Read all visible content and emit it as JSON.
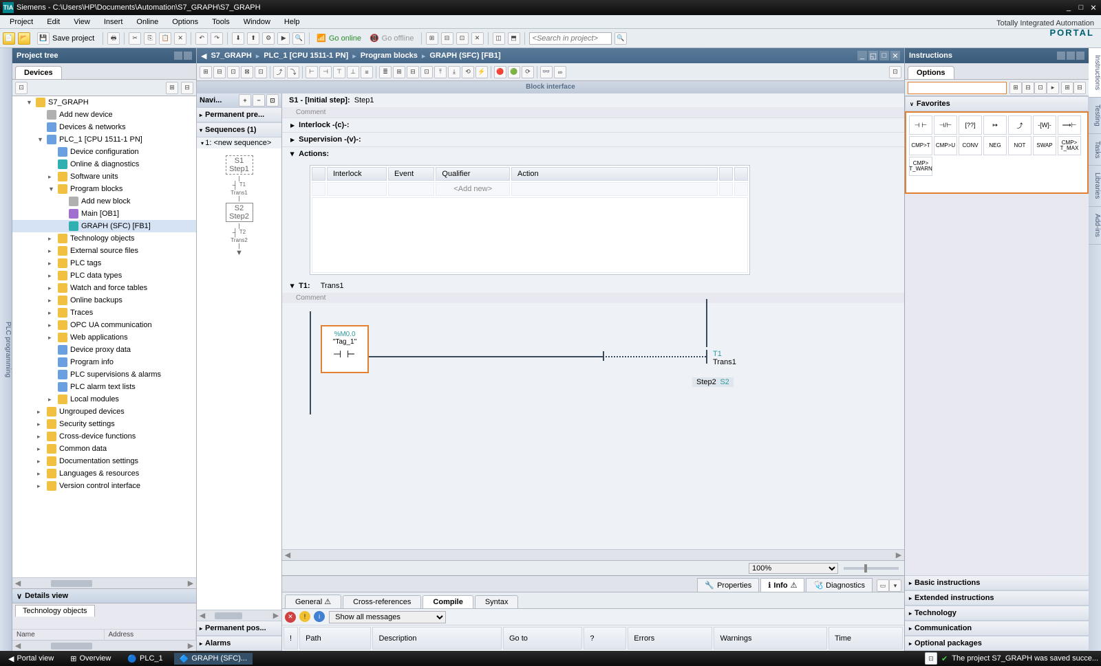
{
  "title": "Siemens  -  C:\\Users\\HP\\Documents\\Automation\\S7_GRAPH\\S7_GRAPH",
  "menu": [
    "Project",
    "Edit",
    "View",
    "Insert",
    "Online",
    "Options",
    "Tools",
    "Window",
    "Help"
  ],
  "brand": {
    "line1": "Totally Integrated Automation",
    "line2": "PORTAL"
  },
  "toolbar": {
    "save": "Save project",
    "goonline": "Go online",
    "gooffline": "Go offline",
    "search_ph": "<Search in project>"
  },
  "projectTree": {
    "title": "Project tree",
    "tab": "Devices",
    "sideTab": "PLC programming"
  },
  "tree": [
    {
      "lvl": 0,
      "exp": "▼",
      "icon": "ic-folder",
      "label": "S7_GRAPH"
    },
    {
      "lvl": 1,
      "exp": "",
      "icon": "ic-grey",
      "label": "Add new device"
    },
    {
      "lvl": 1,
      "exp": "",
      "icon": "ic-block",
      "label": "Devices & networks"
    },
    {
      "lvl": 1,
      "exp": "▼",
      "icon": "ic-block",
      "label": "PLC_1 [CPU 1511-1 PN]"
    },
    {
      "lvl": 2,
      "exp": "",
      "icon": "ic-block",
      "label": "Device configuration"
    },
    {
      "lvl": 2,
      "exp": "",
      "icon": "ic-cyan",
      "label": "Online & diagnostics"
    },
    {
      "lvl": 2,
      "exp": "▸",
      "icon": "ic-folder",
      "label": "Software units"
    },
    {
      "lvl": 2,
      "exp": "▼",
      "icon": "ic-folder",
      "label": "Program blocks"
    },
    {
      "lvl": 3,
      "exp": "",
      "icon": "ic-grey",
      "label": "Add new block"
    },
    {
      "lvl": 3,
      "exp": "",
      "icon": "ic-purple",
      "label": "Main [OB1]"
    },
    {
      "lvl": 3,
      "exp": "",
      "icon": "ic-cyan",
      "label": "GRAPH (SFC) [FB1]",
      "sel": true
    },
    {
      "lvl": 2,
      "exp": "▸",
      "icon": "ic-folder",
      "label": "Technology objects"
    },
    {
      "lvl": 2,
      "exp": "▸",
      "icon": "ic-folder",
      "label": "External source files"
    },
    {
      "lvl": 2,
      "exp": "▸",
      "icon": "ic-folder",
      "label": "PLC tags"
    },
    {
      "lvl": 2,
      "exp": "▸",
      "icon": "ic-folder",
      "label": "PLC data types"
    },
    {
      "lvl": 2,
      "exp": "▸",
      "icon": "ic-folder",
      "label": "Watch and force tables"
    },
    {
      "lvl": 2,
      "exp": "▸",
      "icon": "ic-folder",
      "label": "Online backups"
    },
    {
      "lvl": 2,
      "exp": "▸",
      "icon": "ic-folder",
      "label": "Traces"
    },
    {
      "lvl": 2,
      "exp": "▸",
      "icon": "ic-folder",
      "label": "OPC UA communication"
    },
    {
      "lvl": 2,
      "exp": "▸",
      "icon": "ic-folder",
      "label": "Web applications"
    },
    {
      "lvl": 2,
      "exp": "",
      "icon": "ic-block",
      "label": "Device proxy data"
    },
    {
      "lvl": 2,
      "exp": "",
      "icon": "ic-block",
      "label": "Program info"
    },
    {
      "lvl": 2,
      "exp": "",
      "icon": "ic-block",
      "label": "PLC supervisions & alarms"
    },
    {
      "lvl": 2,
      "exp": "",
      "icon": "ic-block",
      "label": "PLC alarm text lists"
    },
    {
      "lvl": 2,
      "exp": "▸",
      "icon": "ic-folder",
      "label": "Local modules"
    },
    {
      "lvl": 1,
      "exp": "▸",
      "icon": "ic-folder",
      "label": "Ungrouped devices"
    },
    {
      "lvl": 1,
      "exp": "▸",
      "icon": "ic-folder",
      "label": "Security settings"
    },
    {
      "lvl": 1,
      "exp": "▸",
      "icon": "ic-folder",
      "label": "Cross-device functions"
    },
    {
      "lvl": 1,
      "exp": "▸",
      "icon": "ic-folder",
      "label": "Common data"
    },
    {
      "lvl": 1,
      "exp": "▸",
      "icon": "ic-folder",
      "label": "Documentation settings"
    },
    {
      "lvl": 1,
      "exp": "▸",
      "icon": "ic-folder",
      "label": "Languages & resources"
    },
    {
      "lvl": 1,
      "exp": "▸",
      "icon": "ic-folder",
      "label": "Version control interface"
    }
  ],
  "detailsView": {
    "title": "Details view",
    "tab": "Technology objects",
    "cols": [
      "Name",
      "Address"
    ]
  },
  "breadcrumb": [
    "S7_GRAPH",
    "PLC_1 [CPU 1511-1 PN]",
    "Program blocks",
    "GRAPH (SFC) [FB1]"
  ],
  "blockIface": "Block interface",
  "nav": {
    "title": "Navi...",
    "permPre": "Permanent pre...",
    "sequences": "Sequences (1)",
    "seq1": "1: <new sequence>",
    "permPost": "Permanent pos...",
    "alarms": "Alarms",
    "step1": "Step1",
    "s1": "S1",
    "t1": "T1",
    "trans1": "Trans1",
    "step2": "Step2",
    "s2": "S2",
    "t2": "T2",
    "trans2": "Trans2"
  },
  "editor": {
    "stepTitle": {
      "id": "S1 - [Initial step]:",
      "name": "Step1"
    },
    "comment": "Comment",
    "interlock": "Interlock -(c)-:",
    "supervision": "Supervision -(v)-:",
    "actions": "Actions:",
    "actCols": [
      "Interlock",
      "Event",
      "Qualifier",
      "Action"
    ],
    "addnew": "<Add new>",
    "trans": {
      "id": "T1:",
      "name": "Trans1",
      "addr": "%M0.0",
      "tag": "\"Tag_1\"",
      "destStep": "Step2",
      "destId": "S2",
      "tId": "T1",
      "tName": "Trans1"
    }
  },
  "zoom": "100%",
  "info": {
    "tabs": {
      "properties": "Properties",
      "info": "Info",
      "diagnostics": "Diagnostics"
    },
    "subtabs": [
      "General",
      "Cross-references",
      "Compile",
      "Syntax"
    ],
    "msgFilter": "Show all messages",
    "cols": [
      "Path",
      "Description",
      "Go to",
      "?",
      "Errors",
      "Warnings",
      "Time"
    ]
  },
  "instructions": {
    "title": "Instructions",
    "options": "Options",
    "favorites": "Favorites",
    "favIcons": [
      "⊣ ⊢",
      "⊣/⊢",
      "[??]",
      "↦",
      "⤴",
      "-[W]-",
      "⟶⊢"
    ],
    "favTxt": [
      "CMP>T",
      "CMP>U",
      "CONV",
      "NEG",
      "NOT",
      "SWAP",
      "CMP> T_MAX",
      "CMP> T_WARN"
    ],
    "cats": [
      "Basic instructions",
      "Extended instructions",
      "Technology",
      "Communication",
      "Optional packages"
    ]
  },
  "rightTabs": [
    "Instructions",
    "Testing",
    "Tasks",
    "Libraries",
    "Add-ins"
  ],
  "status": {
    "portal": "Portal view",
    "overview": "Overview",
    "plc": "PLC_1",
    "graph": "GRAPH (SFC)...",
    "msg": "The project S7_GRAPH was saved succe..."
  }
}
